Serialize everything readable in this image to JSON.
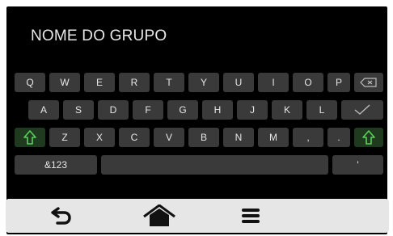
{
  "header": {
    "title": "NOME DO GRUPO"
  },
  "keyboard": {
    "row1": [
      "Q",
      "W",
      "E",
      "R",
      "T",
      "Y",
      "U",
      "I",
      "O",
      "P"
    ],
    "row2": [
      "A",
      "S",
      "D",
      "F",
      "G",
      "H",
      "J",
      "K",
      "L"
    ],
    "row3": [
      "Z",
      "X",
      "C",
      "V",
      "B",
      "N",
      "M",
      ",",
      "."
    ],
    "mode_label": "&123",
    "apostrophe": "'"
  },
  "colors": {
    "background": "#000000",
    "key": "#3a3a3a",
    "shift_key": "#1f3a1f",
    "shift_icon": "#5ad05a",
    "nav_bar": "#e6e6e6"
  },
  "icons": [
    "backspace-icon",
    "checkmark-icon",
    "shift-icon",
    "back-arrow-icon",
    "home-icon",
    "menu-icon"
  ]
}
